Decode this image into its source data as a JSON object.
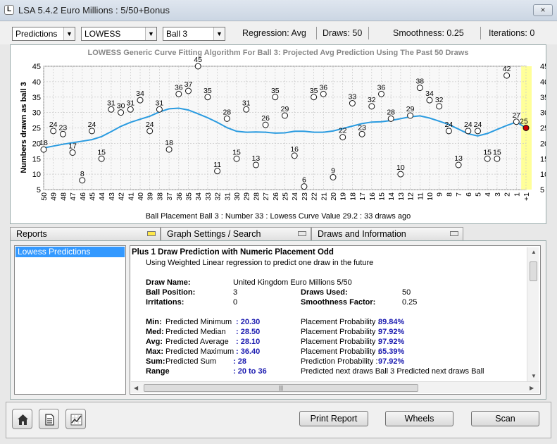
{
  "window": {
    "title": "LSA 5.4.2 Euro Millions : 5/50+Bonus",
    "close_label": "×",
    "app_icon": "L"
  },
  "toolbar": {
    "combo_report": "Predictions",
    "combo_method": "LOWESS",
    "combo_ball": "Ball 3",
    "regression": "Regression: Avg",
    "draws": "Draws: 50",
    "smoothness": "Smoothness: 0.25",
    "iterations": "Iterations: 0"
  },
  "chart_data": {
    "type": "scatter",
    "title": "LOWESS Generic Curve Fitting Algorithm For Ball 3: Projected Avg Prediction Using The Past 50 Draws",
    "ylabel": "Numbers drawn as ball 3",
    "status": "Ball Placement Ball 3 : Number 33 : Lowess Curve Value 29.2 : 33 draws ago",
    "ylim": [
      5,
      45
    ],
    "yticks": [
      5,
      10,
      15,
      20,
      25,
      30,
      35,
      40,
      45
    ],
    "x_labels": [
      "50",
      "49",
      "48",
      "47",
      "46",
      "45",
      "44",
      "43",
      "42",
      "41",
      "40",
      "39",
      "38",
      "37",
      "36",
      "35",
      "34",
      "33",
      "32",
      "31",
      "30",
      "29",
      "28",
      "27",
      "26",
      "25",
      "24",
      "23",
      "22",
      "21",
      "20",
      "19",
      "18",
      "17",
      "16",
      "15",
      "14",
      "13",
      "12",
      "11",
      "10",
      "9",
      "8",
      "7",
      "6",
      "5",
      "4",
      "3",
      "2",
      "1",
      "+1"
    ],
    "values": [
      18,
      24,
      23,
      17,
      8,
      24,
      15,
      31,
      30,
      31,
      34,
      24,
      31,
      18,
      36,
      37,
      45,
      35,
      11,
      28,
      15,
      31,
      13,
      26,
      35,
      29,
      16,
      6,
      35,
      36,
      9,
      22,
      33,
      23,
      32,
      36,
      28,
      10,
      29,
      38,
      34,
      32,
      24,
      13,
      24,
      24,
      15,
      15,
      42,
      27
    ],
    "prediction": {
      "x": "+1",
      "value": 25,
      "label": "25"
    },
    "curve": [
      18.5,
      19.1,
      19.7,
      20.2,
      20.7,
      21.2,
      22.2,
      23.8,
      25.5,
      26.8,
      27.8,
      28.8,
      30.2,
      31.2,
      31.4,
      30.8,
      29.6,
      28.3,
      26.8,
      25.1,
      23.9,
      23.6,
      23.7,
      23.6,
      23.3,
      23.4,
      23.9,
      23.9,
      23.6,
      23.6,
      24.0,
      24.8,
      25.6,
      26.4,
      26.9,
      27.0,
      27.4,
      28.0,
      28.6,
      28.9,
      28.2,
      27.2,
      26.1,
      24.6,
      23.1,
      22.4,
      23.2,
      24.5,
      25.8,
      26.9,
      25.0
    ],
    "colors": {
      "curve": "#2a9be0",
      "highlight": "#ffff99",
      "prediction": "#cc0000"
    },
    "grid": true
  },
  "tabs": [
    "Reports",
    "Graph Settings / Search",
    "Draws and Information"
  ],
  "sidebar": {
    "items": [
      "Lowess Predictions"
    ]
  },
  "report": {
    "title": "Plus 1 Draw Prediction with Numeric Placement Odd",
    "subtitle": "Using Weighted Linear regression to predict one draw in the future",
    "draw_name_label": "Draw Name:",
    "draw_name": "United Kingdom Euro Millions 5/50",
    "ball_position_label": "Ball Position:",
    "ball_position": "3",
    "draws_used_label": "Draws Used:",
    "draws_used": "50",
    "irritations_label": "Irritations:",
    "irritations": "0",
    "smoothness_label": "Smoothness Factor:",
    "smoothness": "0.25",
    "rows": [
      {
        "key": "Min:",
        "label": "Predicted Minimum",
        "value": ": 20.30",
        "prob_label": "Placement Probability :",
        "prob": "89.84%"
      },
      {
        "key": "Med:",
        "label": "Predicted Median",
        "value": ": 28.50",
        "prob_label": "Placement Probability :",
        "prob": "97.92%"
      },
      {
        "key": "Avg:",
        "label": "Predicted Average",
        "value": ": 28.10",
        "prob_label": "Placement Probability :",
        "prob": "97.92%"
      },
      {
        "key": "Max:",
        "label": "Predicted Maximum",
        "value": ": 36.40",
        "prob_label": "Placement Probability :",
        "prob": "65.39%"
      },
      {
        "key": "Sum:",
        "label": "Predicted Sum",
        "value": ": 28",
        "prob_label": "Prediction Probability :",
        "prob": "97.92%"
      }
    ],
    "range_label": "Range",
    "range_value": ": 20 to 36",
    "range_note": "Predicted next draws Ball 3 Predicted next draws Ball"
  },
  "buttons": {
    "print": "Print Report",
    "wheels": "Wheels",
    "scan": "Scan"
  },
  "icons": {
    "home": "home-icon",
    "document": "document-icon",
    "chart": "chart-icon"
  }
}
